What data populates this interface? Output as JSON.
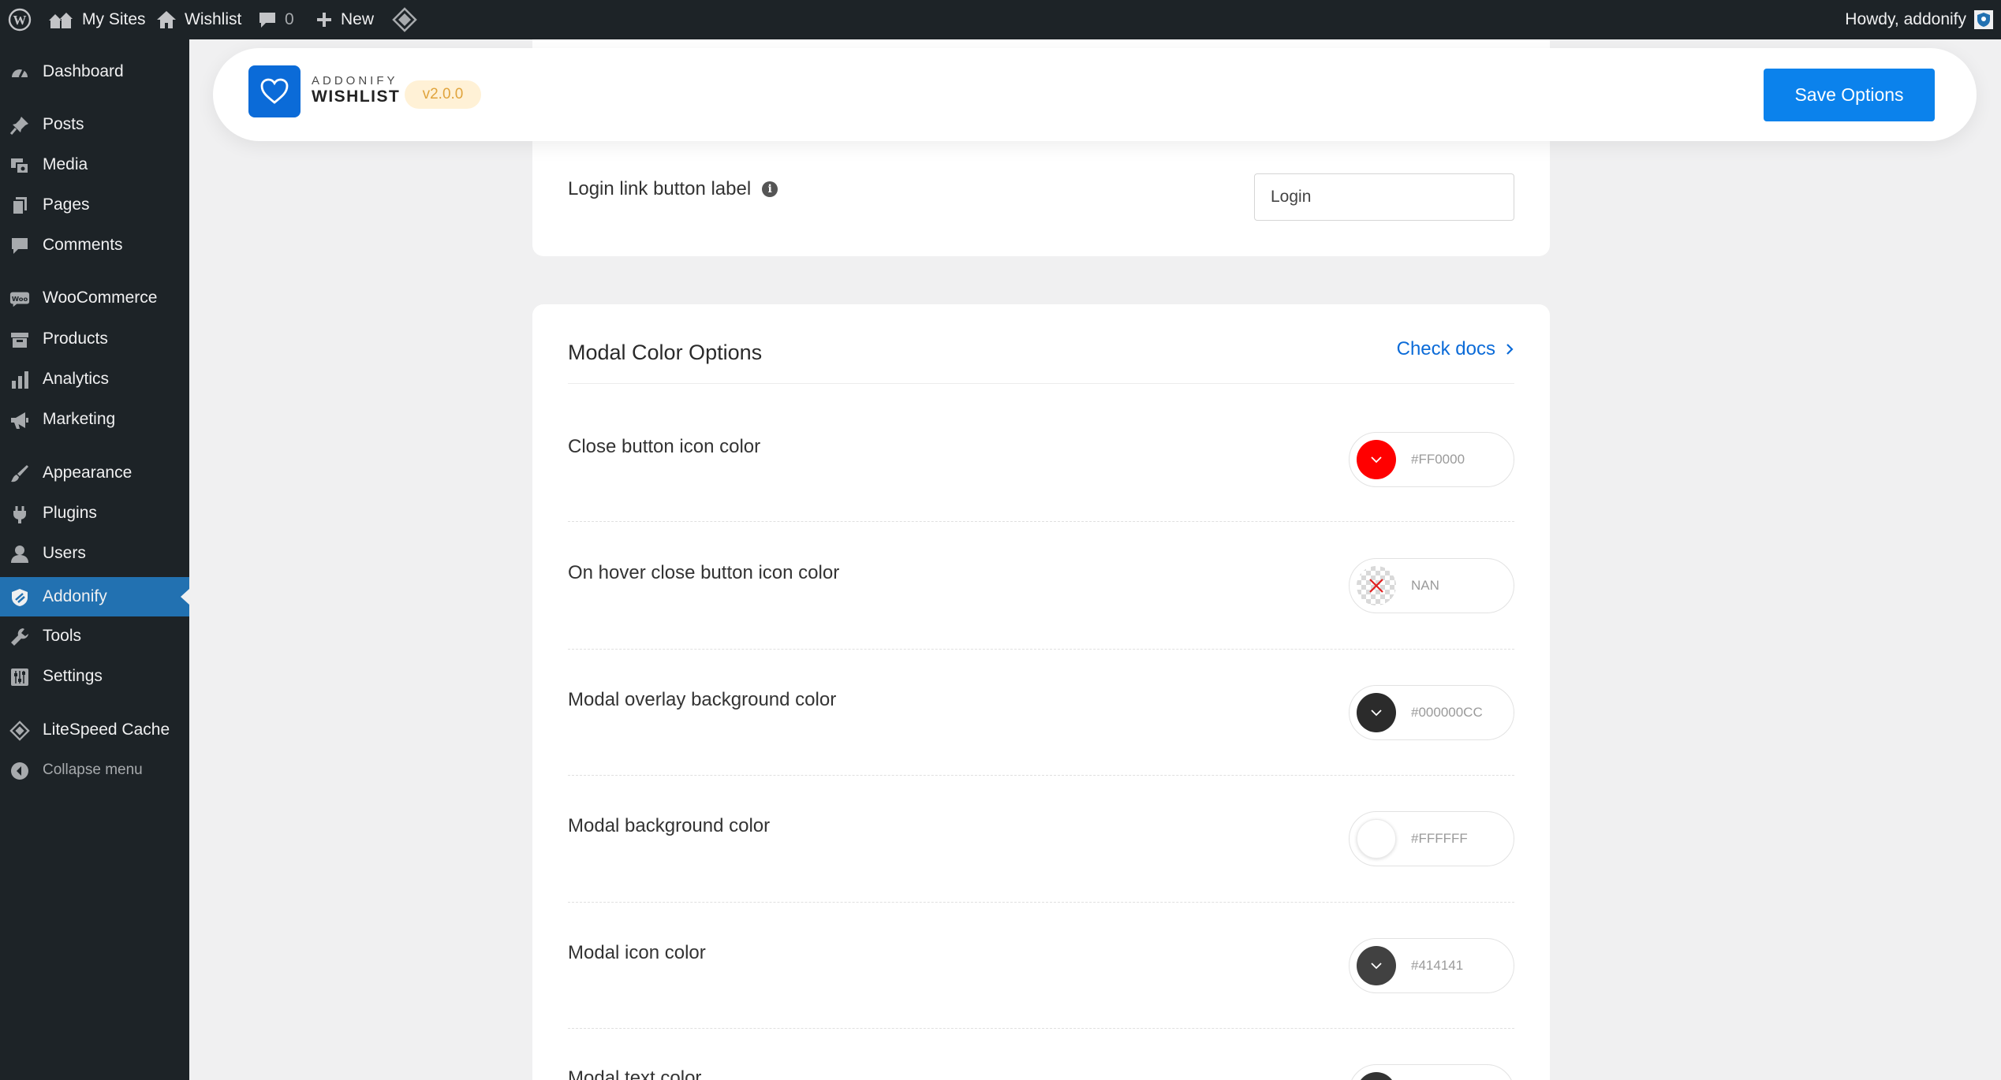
{
  "admin_bar": {
    "my_sites": "My Sites",
    "site_name": "Wishlist",
    "comments_count": "0",
    "new_label": "New",
    "greeting": "Howdy, addonify"
  },
  "sidebar": {
    "items": [
      {
        "label": "Dashboard",
        "icon": "dashboard-icon"
      },
      {
        "label": "Posts",
        "icon": "pin-icon"
      },
      {
        "label": "Media",
        "icon": "media-icon"
      },
      {
        "label": "Pages",
        "icon": "pages-icon"
      },
      {
        "label": "Comments",
        "icon": "comment-icon"
      },
      {
        "label": "WooCommerce",
        "icon": "woo-icon"
      },
      {
        "label": "Products",
        "icon": "archive-icon"
      },
      {
        "label": "Analytics",
        "icon": "bar-chart-icon"
      },
      {
        "label": "Marketing",
        "icon": "megaphone-icon"
      },
      {
        "label": "Appearance",
        "icon": "brush-icon"
      },
      {
        "label": "Plugins",
        "icon": "plug-icon"
      },
      {
        "label": "Users",
        "icon": "user-icon"
      },
      {
        "label": "Addonify",
        "icon": "addonify-icon",
        "active": true
      },
      {
        "label": "Tools",
        "icon": "wrench-icon"
      },
      {
        "label": "Settings",
        "icon": "sliders-icon"
      },
      {
        "label": "LiteSpeed Cache",
        "icon": "diamond-icon"
      }
    ],
    "collapse_label": "Collapse menu"
  },
  "header": {
    "brand_top": "ADDONIFY",
    "brand_name": "WISHLIST",
    "version": "v2.0.0",
    "save_label": "Save Options",
    "brand_color": "#0b6bd8"
  },
  "login_section": {
    "label": "Login link button label",
    "value": "Login"
  },
  "modal_colors": {
    "title": "Modal Color Options",
    "docs_link": "Check docs",
    "options": [
      {
        "label": "Close button icon color",
        "hex": "#FF0000",
        "swatch": "#FF0000"
      },
      {
        "label": "On hover close button icon color",
        "hex": "NAN",
        "swatch": "none"
      },
      {
        "label": "Modal overlay background color",
        "hex": "#000000CC",
        "swatch": "#2b2b2b"
      },
      {
        "label": "Modal background color",
        "hex": "#FFFFFF",
        "swatch": "#FFFFFF"
      },
      {
        "label": "Modal icon color",
        "hex": "#414141",
        "swatch": "#414141"
      },
      {
        "label": "Modal text color",
        "hex": "",
        "swatch": "#333333"
      }
    ]
  }
}
